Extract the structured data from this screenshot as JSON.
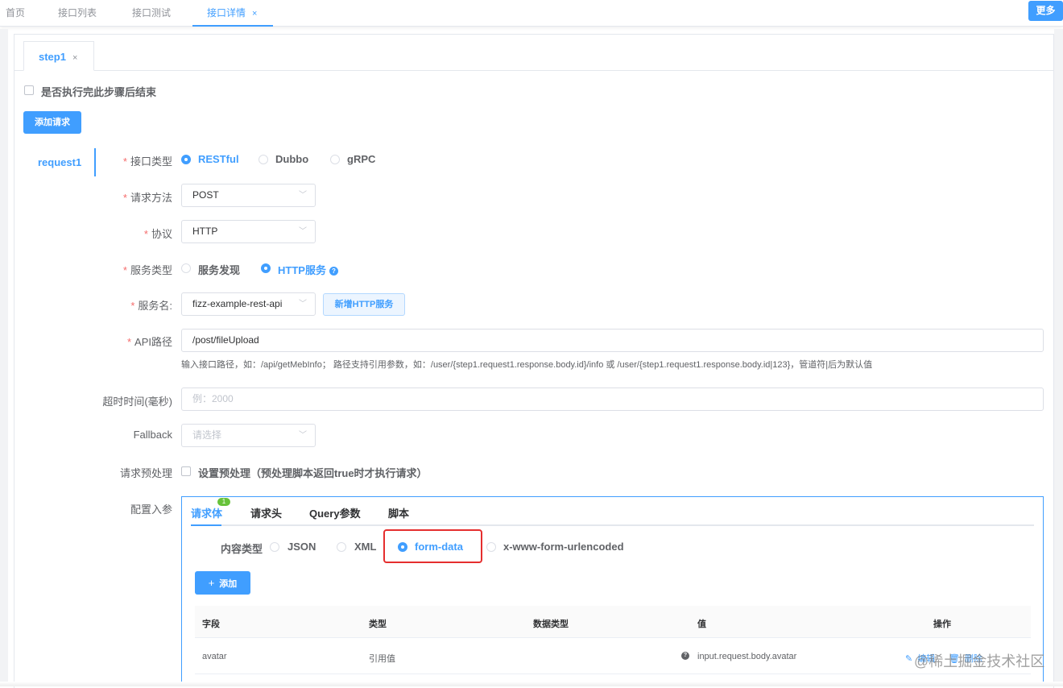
{
  "top_tabs": [
    {
      "label": "首页"
    },
    {
      "label": "接口列表"
    },
    {
      "label": "接口测试"
    },
    {
      "label": "接口详情",
      "close": "×"
    }
  ],
  "more_button": "更多",
  "step_tab": {
    "label": "step1",
    "close": "×"
  },
  "end_after_step": {
    "label": "是否执行完此步骤后结束",
    "checked": false
  },
  "add_request_button": "添加请求",
  "request_tab": "request1",
  "form": {
    "interface_type": {
      "label": "接口类型",
      "options": [
        "RESTful",
        "Dubbo",
        "gRPC"
      ],
      "selected": "RESTful"
    },
    "method": {
      "label": "请求方法",
      "value": "POST"
    },
    "protocol": {
      "label": "协议",
      "value": "HTTP"
    },
    "service_type": {
      "label": "服务类型",
      "options": [
        "服务发现",
        "HTTP服务"
      ],
      "selected": "HTTP服务",
      "help_icon": "?"
    },
    "service_name": {
      "label": "服务名:",
      "value": "fizz-example-rest-api",
      "add_button": "新增HTTP服务"
    },
    "api_path": {
      "label": "API路径",
      "value": "/post/fileUpload",
      "hint": "输入接口路径，如：/api/getMebInfo； 路径支持引用参数，如：/user/{step1.request1.response.body.id}/info 或 /user/{step1.request1.response.body.id|123}，管道符|后为默认值"
    },
    "timeout": {
      "label": "超时时间(毫秒)",
      "placeholder": "例：2000"
    },
    "fallback": {
      "label": "Fallback",
      "placeholder": "请选择"
    },
    "preprocess": {
      "label": "请求预处理",
      "checkbox_label": "设置预处理（预处理脚本返回true时才执行请求）",
      "checked": false
    },
    "config_params": {
      "label": "配置入参"
    }
  },
  "config_tabs": [
    {
      "label": "请求体",
      "badge": "1"
    },
    {
      "label": "请求头"
    },
    {
      "label": "Query参数"
    },
    {
      "label": "脚本"
    }
  ],
  "content_type": {
    "label": "内容类型",
    "options": [
      "JSON",
      "XML",
      "form-data",
      "x-www-form-urlencoded"
    ],
    "selected": "form-data"
  },
  "add_button": {
    "icon": "+",
    "label": "添加"
  },
  "table": {
    "headers": [
      "字段",
      "类型",
      "数据类型",
      "值",
      "操作"
    ],
    "rows": [
      {
        "field": "avatar",
        "type": "引用值",
        "data_type": "",
        "value": "input.request.body.avatar",
        "value_icon": "?",
        "actions": [
          "编辑",
          "删除"
        ]
      }
    ]
  },
  "watermark": "@稀土掘金技术社区",
  "colors": {
    "primary": "#409eff",
    "required": "#f56c6c",
    "highlight_box": "#e52e2e",
    "badge": "#67c23a"
  }
}
